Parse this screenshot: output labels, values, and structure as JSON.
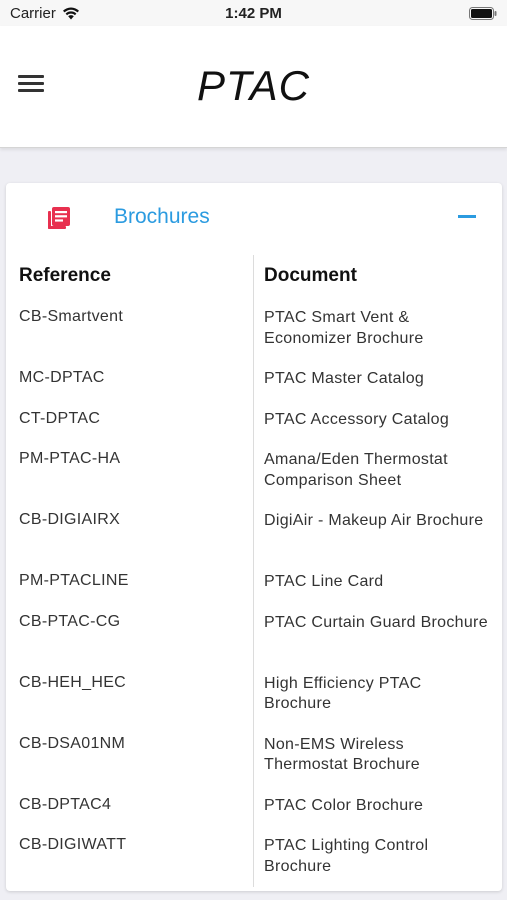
{
  "status_bar": {
    "carrier": "Carrier",
    "time": "1:42 PM"
  },
  "nav": {
    "title": "PTAC"
  },
  "section": {
    "title": "Brochures"
  },
  "table": {
    "headers": {
      "reference": "Reference",
      "document": "Document"
    },
    "rows": [
      {
        "reference": "CB-Smartvent",
        "document": "PTAC Smart Vent & Economizer Brochure"
      },
      {
        "reference": "MC-DPTAC",
        "document": "PTAC Master Catalog"
      },
      {
        "reference": "CT-DPTAC",
        "document": "PTAC Accessory Catalog"
      },
      {
        "reference": "PM-PTAC-HA",
        "document": "Amana/Eden Thermostat Comparison Sheet"
      },
      {
        "reference": "CB-DIGIAIRX",
        "document": "DigiAir - Makeup Air Brochure"
      },
      {
        "reference": "PM-PTACLINE",
        "document": "PTAC Line Card"
      },
      {
        "reference": "CB-PTAC-CG",
        "document": "PTAC Curtain Guard Brochure"
      },
      {
        "reference": "CB-HEH_HEC",
        "document": "High Efficiency PTAC Brochure"
      },
      {
        "reference": "CB-DSA01NM",
        "document": "Non-EMS Wireless Thermostat Brochure"
      },
      {
        "reference": "CB-DPTAC4",
        "document": "PTAC Color Brochure"
      },
      {
        "reference": "CB-DIGIWATT",
        "document": "PTAC Lighting Control Brochure"
      }
    ]
  },
  "colors": {
    "accent": "#2b9be0",
    "icon": "#e8304f"
  }
}
